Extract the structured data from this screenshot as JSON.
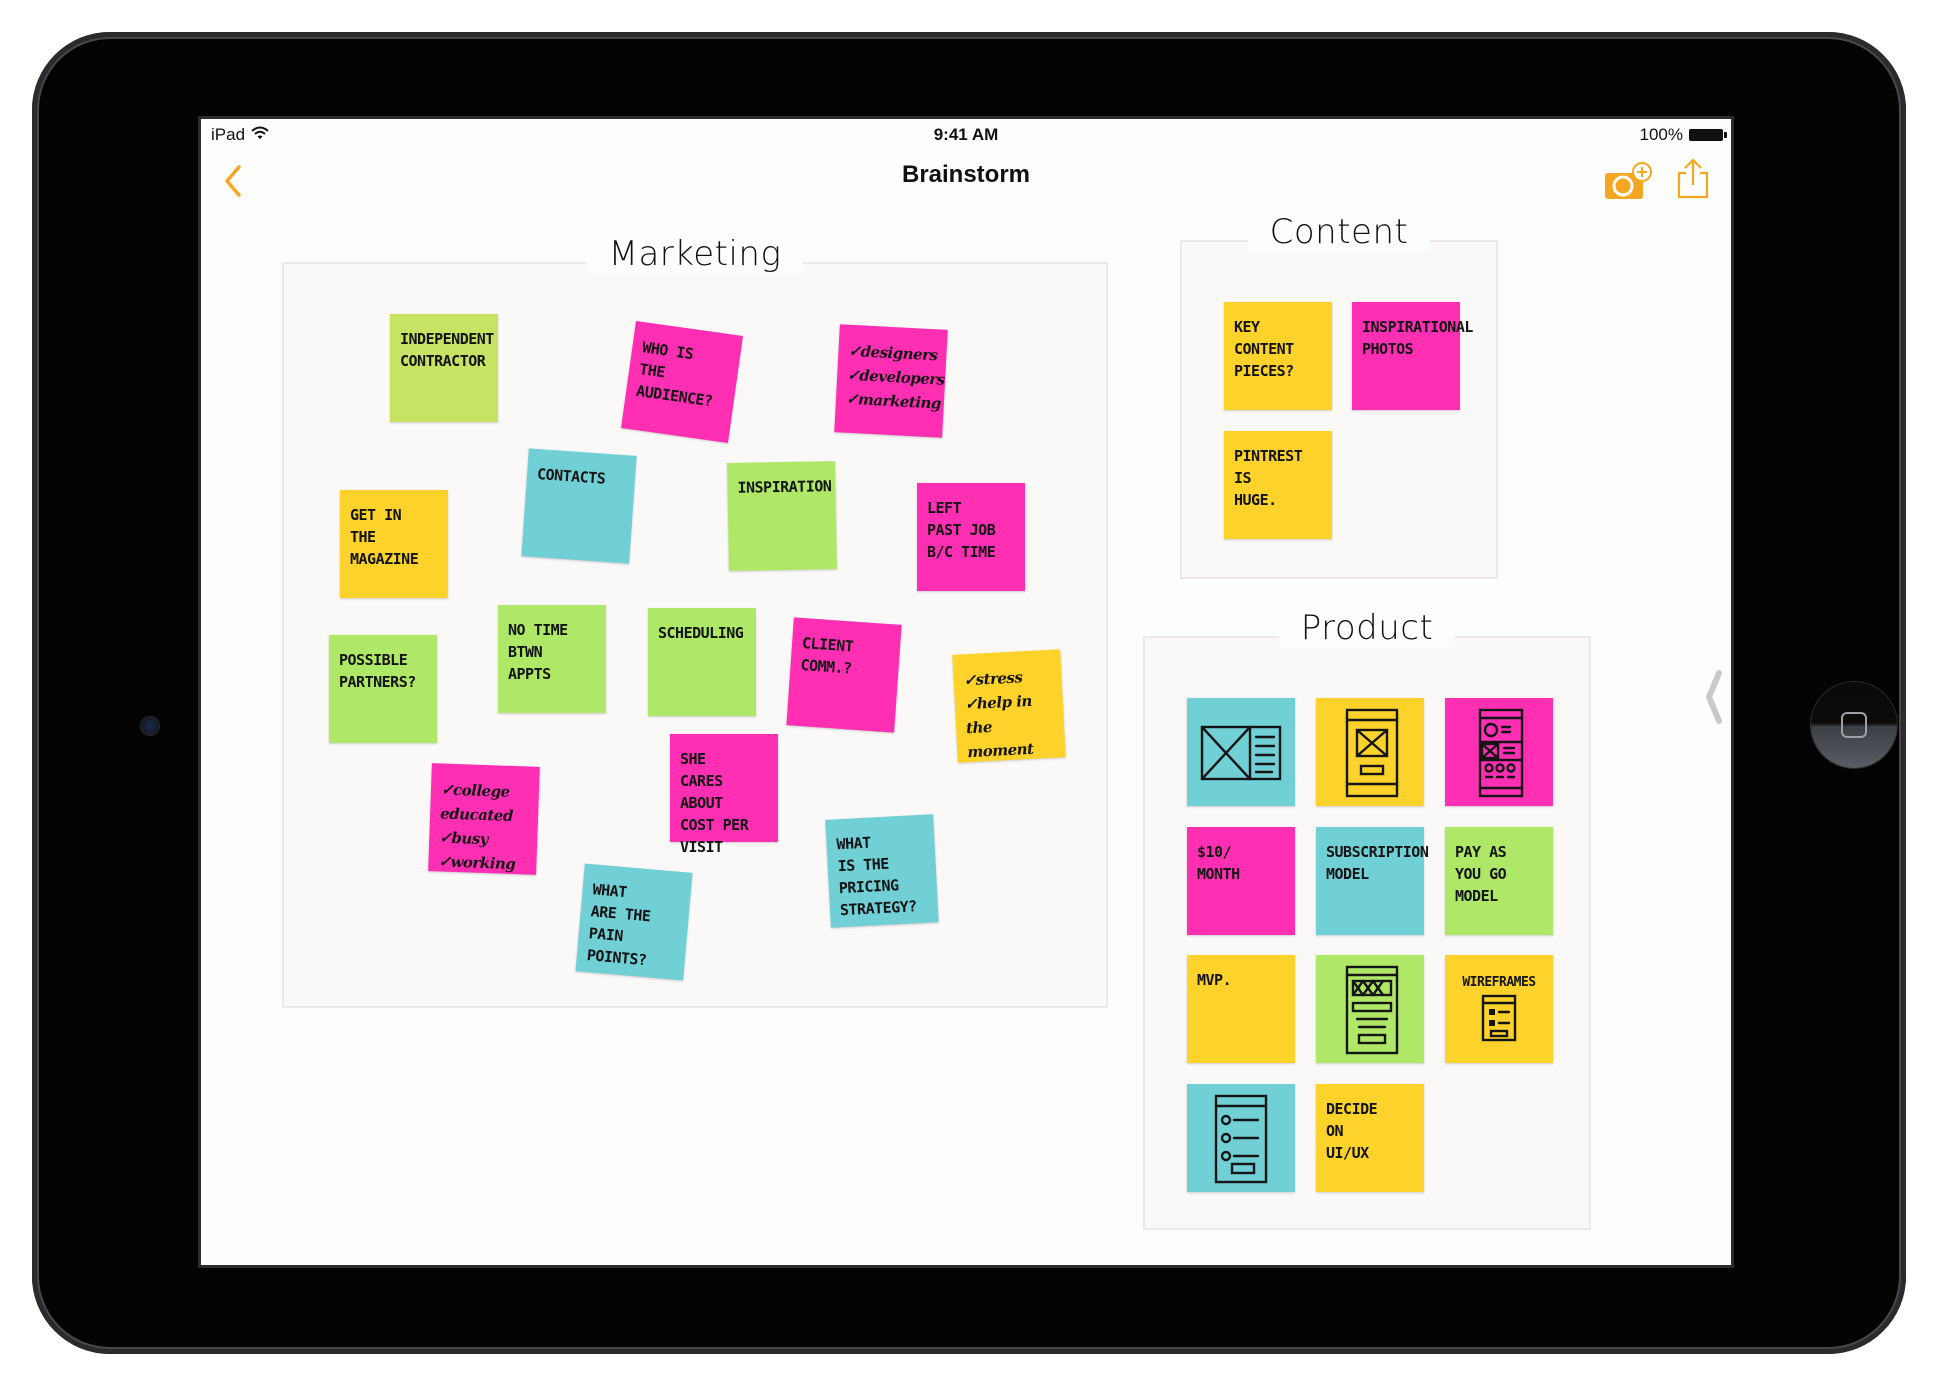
{
  "status_bar": {
    "device": "iPad",
    "time": "9:41 AM",
    "battery": "100%"
  },
  "nav": {
    "title": "Brainstorm",
    "back_icon": "chevron-left-icon",
    "camera_icon": "add-photo-icon",
    "share_icon": "share-icon"
  },
  "colors": {
    "accent": "#f5a623",
    "yellow": "#fdd22a",
    "pink": "#ff2fb4",
    "teal": "#70d0d6",
    "green": "#aee866",
    "lime": "#c6e363"
  },
  "boards": {
    "marketing": {
      "title": "Marketing",
      "notes": [
        {
          "text": "Independent\nContractor",
          "color": "lime"
        },
        {
          "text": "Who is\nthe\naudience?",
          "color": "pink"
        },
        {
          "text": "✓designers\n✓developers\n✓marketing",
          "color": "pink"
        },
        {
          "text": "Get in\nthe\nmagazine",
          "color": "yellow"
        },
        {
          "text": "Contacts",
          "color": "teal"
        },
        {
          "text": "Inspiration",
          "color": "green"
        },
        {
          "text": "Left\npast job\nb/c time",
          "color": "pink"
        },
        {
          "text": "Possible\npartners?",
          "color": "green"
        },
        {
          "text": "No time\nbtwn\nappts",
          "color": "green"
        },
        {
          "text": "Scheduling",
          "color": "green"
        },
        {
          "text": "Client\ncomm.?",
          "color": "pink"
        },
        {
          "text": "✓stress\n✓help in\nthe moment",
          "color": "yellow"
        },
        {
          "text": "She\ncares about\ncost per\nvisit",
          "color": "pink"
        },
        {
          "text": "✓college\neducated\n✓busy\n✓working",
          "color": "pink"
        },
        {
          "text": "What\nare the\npain\npoints?",
          "color": "teal"
        },
        {
          "text": "What\nis the\npricing\nstrategy?",
          "color": "teal"
        }
      ]
    },
    "content": {
      "title": "Content",
      "notes": [
        {
          "text": "Key\ncontent\npieces?",
          "color": "yellow"
        },
        {
          "text": "Inspirational\nphotos",
          "color": "pink"
        },
        {
          "text": "Pintrest\nis\nhuge.",
          "color": "yellow"
        }
      ]
    },
    "product": {
      "title": "Product",
      "notes": [
        {
          "text": "",
          "sketch": "wireframe-web-layout",
          "color": "teal"
        },
        {
          "text": "",
          "sketch": "wireframe-mobile-image",
          "color": "yellow"
        },
        {
          "text": "",
          "sketch": "wireframe-mobile-grid",
          "color": "pink"
        },
        {
          "text": "$10/\nmonth",
          "color": "pink"
        },
        {
          "text": "Subscription\nmodel",
          "color": "teal"
        },
        {
          "text": "Pay as\nyou go\nmodel",
          "color": "green"
        },
        {
          "text": "MVP.",
          "color": "yellow"
        },
        {
          "text": "",
          "sketch": "wireframe-mobile-form",
          "color": "green"
        },
        {
          "text": "Wireframes",
          "sketch": "wireframe-small-list",
          "color": "yellow"
        },
        {
          "text": "",
          "sketch": "wireframe-mobile-list",
          "color": "teal"
        },
        {
          "text": "Decide\non\nUI/UX",
          "color": "yellow"
        }
      ]
    }
  }
}
